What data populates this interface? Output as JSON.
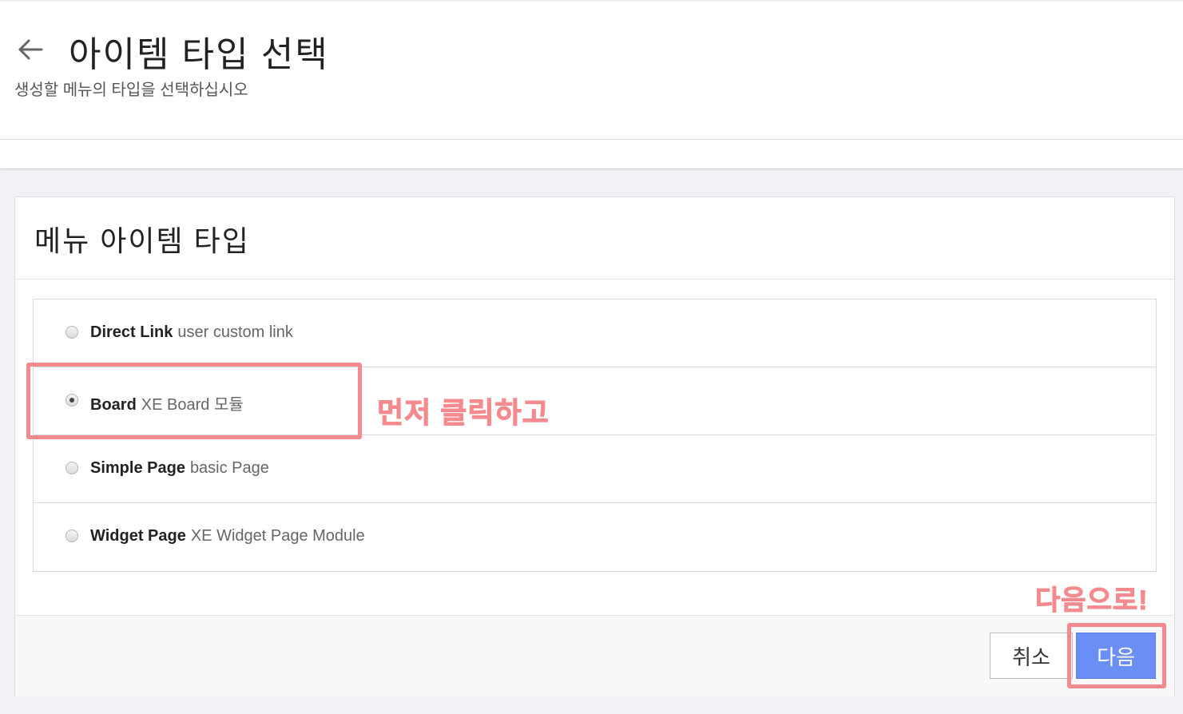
{
  "header": {
    "title": "아이템 타입 선택",
    "subtitle": "생성할 메뉴의 타입을 선택하십시오"
  },
  "panel": {
    "title": "메뉴 아이템 타입",
    "items": [
      {
        "name": "Direct Link",
        "desc": "user custom link",
        "checked": false
      },
      {
        "name": "Board",
        "desc": "XE Board 모듈",
        "checked": true
      },
      {
        "name": "Simple Page",
        "desc": "basic Page",
        "checked": false
      },
      {
        "name": "Widget Page",
        "desc": "XE Widget Page Module",
        "checked": false
      }
    ]
  },
  "buttons": {
    "cancel": "취소",
    "next": "다음"
  },
  "annotations": {
    "click_first": "먼저 클릭하고",
    "next_step": "다음으로!"
  },
  "colors": {
    "annotation": "#f48a8e",
    "primary_button": "#6b8ef5"
  }
}
